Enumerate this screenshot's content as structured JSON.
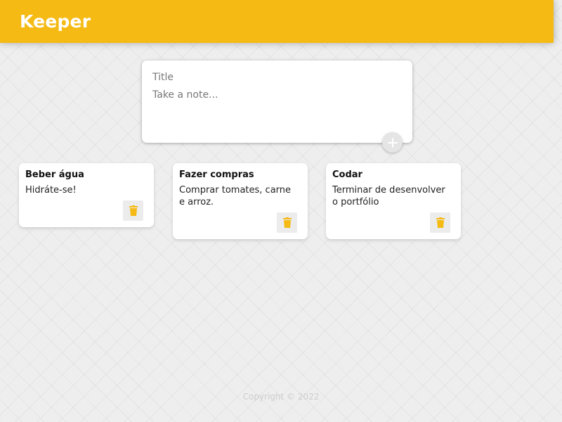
{
  "app": {
    "title": "Keeper"
  },
  "colors": {
    "accent": "#f5ba13",
    "background": "#eeeeee",
    "card": "#ffffff"
  },
  "create_note": {
    "title_placeholder": "Title",
    "content_placeholder": "Take a note...",
    "add_icon": "plus-icon"
  },
  "notes": [
    {
      "title": "Beber água",
      "content": "Hidráte-se!",
      "delete_icon": "trash-icon"
    },
    {
      "title": "Fazer compras",
      "content": "Comprar tomates, carne\ne arroz.",
      "delete_icon": "trash-icon"
    },
    {
      "title": "Codar",
      "content": "Terminar de desenvolver\no portfólio",
      "delete_icon": "trash-icon"
    }
  ],
  "footer": {
    "text": "Copyright © 2022"
  }
}
